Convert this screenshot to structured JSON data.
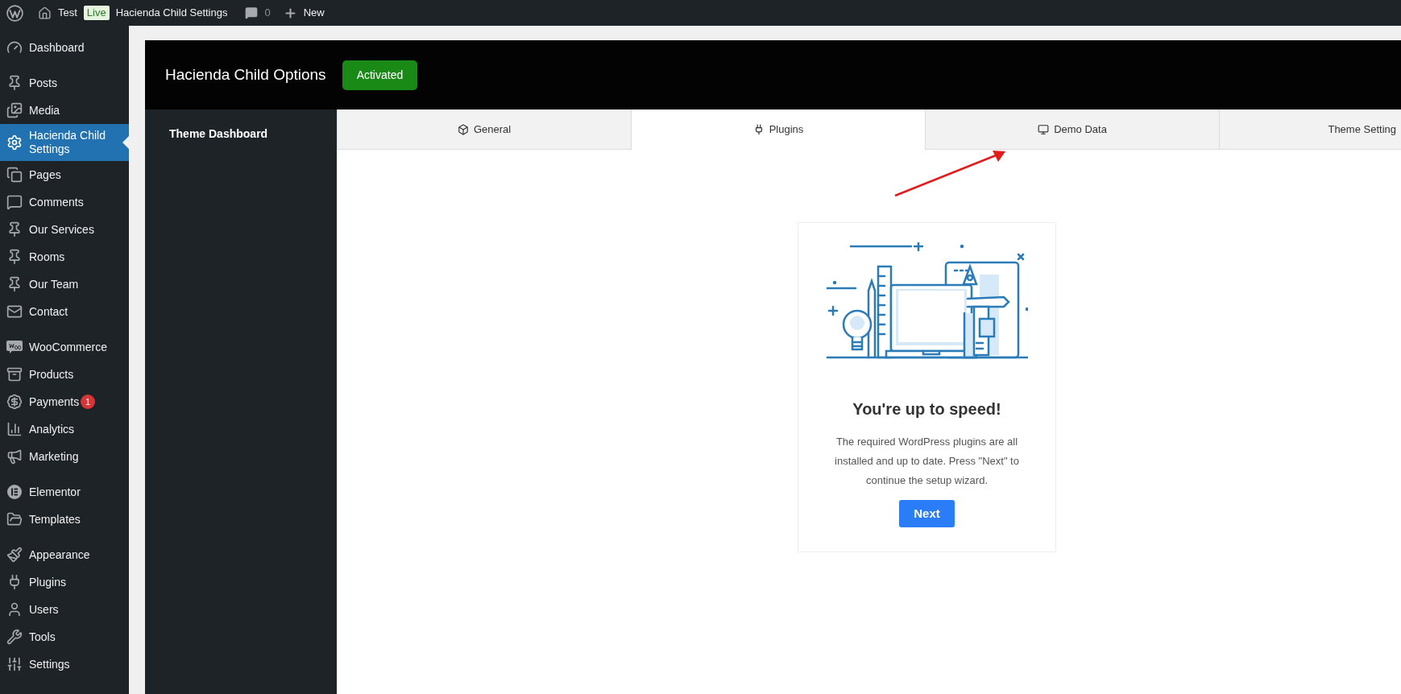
{
  "top_bar": {
    "site_name": "Test",
    "env_badge": "Live",
    "page_link": "Hacienda Child Settings",
    "comments_count": "0",
    "new_label": "New"
  },
  "admin_menu": {
    "groups": [
      {
        "items": [
          {
            "label": "Dashboard",
            "selected": false
          }
        ]
      },
      {
        "items": [
          {
            "label": "Posts",
            "selected": false
          },
          {
            "label": "Media",
            "selected": false
          },
          {
            "label": "Hacienda Child Settings",
            "selected": true
          },
          {
            "label": "Pages",
            "selected": false
          },
          {
            "label": "Comments",
            "selected": false
          },
          {
            "label": "Our Services",
            "selected": false
          },
          {
            "label": "Rooms",
            "selected": false
          },
          {
            "label": "Our Team",
            "selected": false
          },
          {
            "label": "Contact",
            "selected": false
          }
        ]
      },
      {
        "items": [
          {
            "label": "WooCommerce",
            "selected": false
          },
          {
            "label": "Products",
            "selected": false
          },
          {
            "label": "Payments",
            "selected": false,
            "badge": "1"
          },
          {
            "label": "Analytics",
            "selected": false
          },
          {
            "label": "Marketing",
            "selected": false
          }
        ]
      },
      {
        "items": [
          {
            "label": "Elementor",
            "selected": false
          },
          {
            "label": "Templates",
            "selected": false
          }
        ]
      },
      {
        "items": [
          {
            "label": "Appearance",
            "selected": false
          },
          {
            "label": "Plugins",
            "selected": false
          },
          {
            "label": "Users",
            "selected": false
          },
          {
            "label": "Tools",
            "selected": false
          },
          {
            "label": "Settings",
            "selected": false
          }
        ]
      }
    ]
  },
  "options_panel": {
    "title": "Hacienda Child Options",
    "status": "Activated",
    "side_nav": [
      "Theme Dashboard"
    ],
    "tabs": [
      {
        "label": "General",
        "selected": false
      },
      {
        "label": "Plugins",
        "selected": true
      },
      {
        "label": "Demo Data",
        "selected": false
      },
      {
        "label": "Theme Setting",
        "selected": false
      }
    ],
    "card": {
      "heading": "You're up to speed!",
      "body": "The required WordPress plugins are all installed and up to date. Press \"Next\" to continue the setup wizard.",
      "button": "Next"
    }
  }
}
